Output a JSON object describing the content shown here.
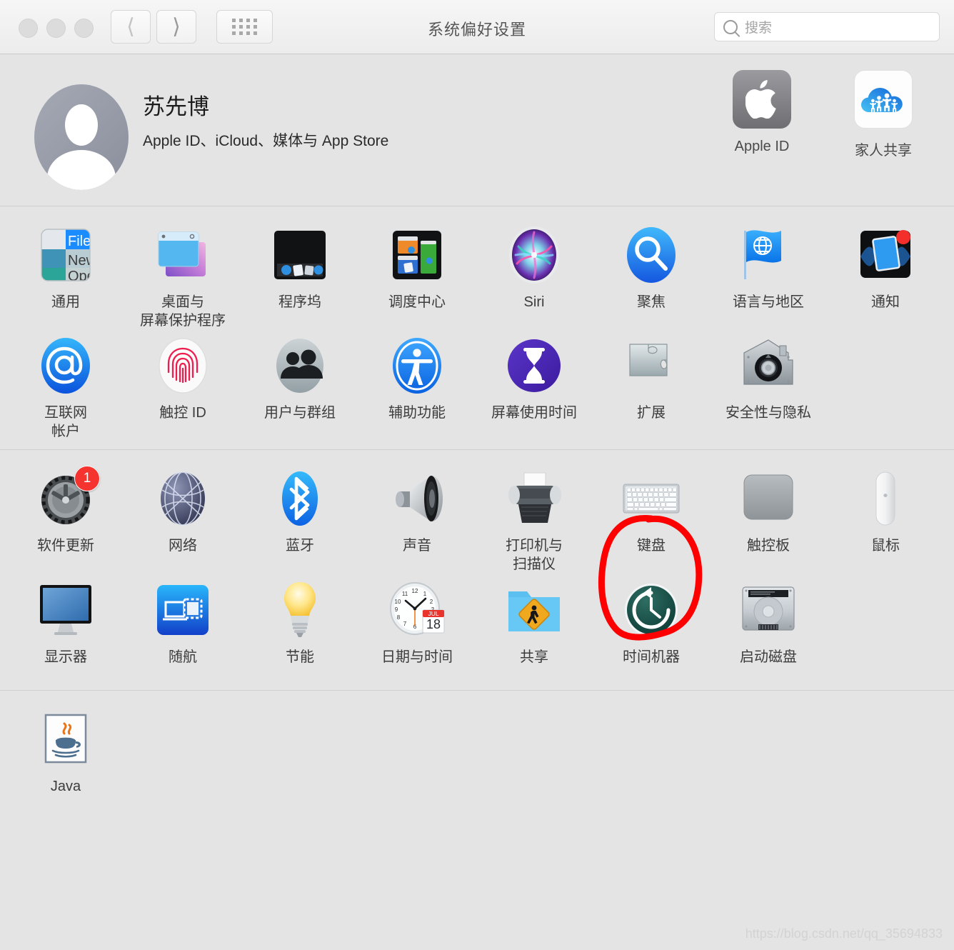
{
  "window": {
    "title": "系统偏好设置",
    "traffic_lights": [
      "close",
      "minimize",
      "zoom"
    ],
    "nav": {
      "back_label": "‹",
      "forward_label": "›",
      "show_all_label": "show-all-grid"
    },
    "search": {
      "placeholder": "搜索",
      "value": ""
    }
  },
  "account": {
    "name": "苏先博",
    "subtitle": "Apple ID、iCloud、媒体与 App Store",
    "tiles": [
      {
        "label": "Apple ID",
        "icon": "apple-logo-icon"
      },
      {
        "label": "家人共享",
        "icon": "family-sharing-cloud-icon"
      }
    ]
  },
  "sections": [
    {
      "name": "personal",
      "items": [
        {
          "label": "通用",
          "icon": "general-icon"
        },
        {
          "label": "桌面与\n屏幕保护程序",
          "icon": "desktop-screensaver-icon"
        },
        {
          "label": "程序坞",
          "icon": "dock-icon"
        },
        {
          "label": "调度中心",
          "icon": "mission-control-icon"
        },
        {
          "label": "Siri",
          "icon": "siri-icon"
        },
        {
          "label": "聚焦",
          "icon": "spotlight-icon"
        },
        {
          "label": "语言与地区",
          "icon": "language-region-flag-icon"
        },
        {
          "label": "通知",
          "icon": "notifications-icon"
        },
        {
          "label": "互联网\n帐户",
          "icon": "internet-accounts-at-icon"
        },
        {
          "label": "触控 ID",
          "icon": "touch-id-fingerprint-icon"
        },
        {
          "label": "用户与群组",
          "icon": "users-groups-icon"
        },
        {
          "label": "辅助功能",
          "icon": "accessibility-icon"
        },
        {
          "label": "屏幕使用时间",
          "icon": "screen-time-hourglass-icon"
        },
        {
          "label": "扩展",
          "icon": "extensions-puzzle-icon"
        },
        {
          "label": "安全性与隐私",
          "icon": "security-privacy-house-icon"
        }
      ]
    },
    {
      "name": "hardware",
      "items": [
        {
          "label": "软件更新",
          "icon": "software-update-gear-icon",
          "badge": "1"
        },
        {
          "label": "网络",
          "icon": "network-globe-icon"
        },
        {
          "label": "蓝牙",
          "icon": "bluetooth-icon"
        },
        {
          "label": "声音",
          "icon": "sound-speaker-icon"
        },
        {
          "label": "打印机与\n扫描仪",
          "icon": "printers-scanners-icon"
        },
        {
          "label": "键盘",
          "icon": "keyboard-icon",
          "annotated": true
        },
        {
          "label": "触控板",
          "icon": "trackpad-icon"
        },
        {
          "label": "鼠标",
          "icon": "mouse-icon"
        },
        {
          "label": "显示器",
          "icon": "displays-icon"
        },
        {
          "label": "随航",
          "icon": "sidecar-icon"
        },
        {
          "label": "节能",
          "icon": "energy-saver-bulb-icon"
        },
        {
          "label": "日期与时间",
          "icon": "date-time-clock-icon",
          "calendar_month": "JUL",
          "calendar_day": "18"
        },
        {
          "label": "共享",
          "icon": "sharing-folder-icon"
        },
        {
          "label": "时间机器",
          "icon": "time-machine-icon"
        },
        {
          "label": "启动磁盘",
          "icon": "startup-disk-icon"
        }
      ]
    },
    {
      "name": "third-party",
      "items": [
        {
          "label": "Java",
          "icon": "java-coffee-cup-icon"
        }
      ]
    }
  ],
  "annotation": {
    "type": "hand-drawn-circle",
    "color": "#fe0000",
    "target": "键盘"
  },
  "watermark": "https://blog.csdn.net/qq_35694833",
  "colors": {
    "background": "#e4e4e4",
    "badge_red": "#f5332f",
    "accent_blue": "#1a8cff"
  }
}
